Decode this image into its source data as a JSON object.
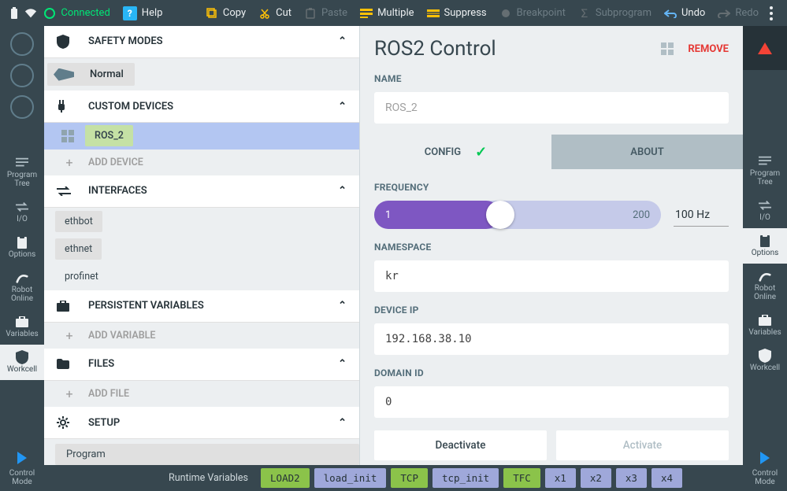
{
  "topbar": {
    "connected": "Connected",
    "help": "Help",
    "copy": "Copy",
    "cut": "Cut",
    "paste": "Paste",
    "multiple": "Multiple",
    "suppress": "Suppress",
    "breakpoint": "Breakpoint",
    "subprogram": "Subprogram",
    "undo": "Undo",
    "redo": "Redo"
  },
  "rail": {
    "program_tree": "Program\nTree",
    "io": "I/O",
    "options": "Options",
    "robot_online": "Robot\nOnline",
    "variables": "Variables",
    "workcell": "Workcell",
    "control_mode": "Control\nMode"
  },
  "tree": {
    "safety_modes": "SAFETY MODES",
    "normal": "Normal",
    "custom_devices": "CUSTOM DEVICES",
    "ros2": "ROS_2",
    "add_device": "ADD DEVICE",
    "interfaces": "INTERFACES",
    "iface_items": [
      "ethbot",
      "ethnet",
      "profinet"
    ],
    "persistent_vars": "PERSISTENT VARIABLES",
    "add_variable": "ADD VARIABLE",
    "files": "FILES",
    "add_file": "ADD FILE",
    "setup": "SETUP",
    "program": "Program"
  },
  "details": {
    "title": "ROS2 Control",
    "remove": "REMOVE",
    "name_label": "NAME",
    "name_value": "ROS_2",
    "tab_config": "CONFIG",
    "tab_about": "ABOUT",
    "freq_label": "FREQUENCY",
    "freq_min": "1",
    "freq_max": "200",
    "freq_value": "100  Hz",
    "ns_label": "NAMESPACE",
    "ns_value": "kr",
    "ip_label": "DEVICE IP",
    "ip_value": "192.168.38.10",
    "domain_label": "DOMAIN ID",
    "domain_value": "0",
    "deactivate": "Deactivate",
    "activate": "Activate"
  },
  "runtime": {
    "label": "Runtime Variables",
    "chips": [
      {
        "t": "LOAD2",
        "c": "g"
      },
      {
        "t": "load_init",
        "c": "p"
      },
      {
        "t": "TCP",
        "c": "g"
      },
      {
        "t": "tcp_init",
        "c": "p"
      },
      {
        "t": "TFC",
        "c": "g"
      },
      {
        "t": "x1",
        "c": "p"
      },
      {
        "t": "x2",
        "c": "p"
      },
      {
        "t": "x3",
        "c": "p"
      },
      {
        "t": "x4",
        "c": "p"
      }
    ]
  }
}
